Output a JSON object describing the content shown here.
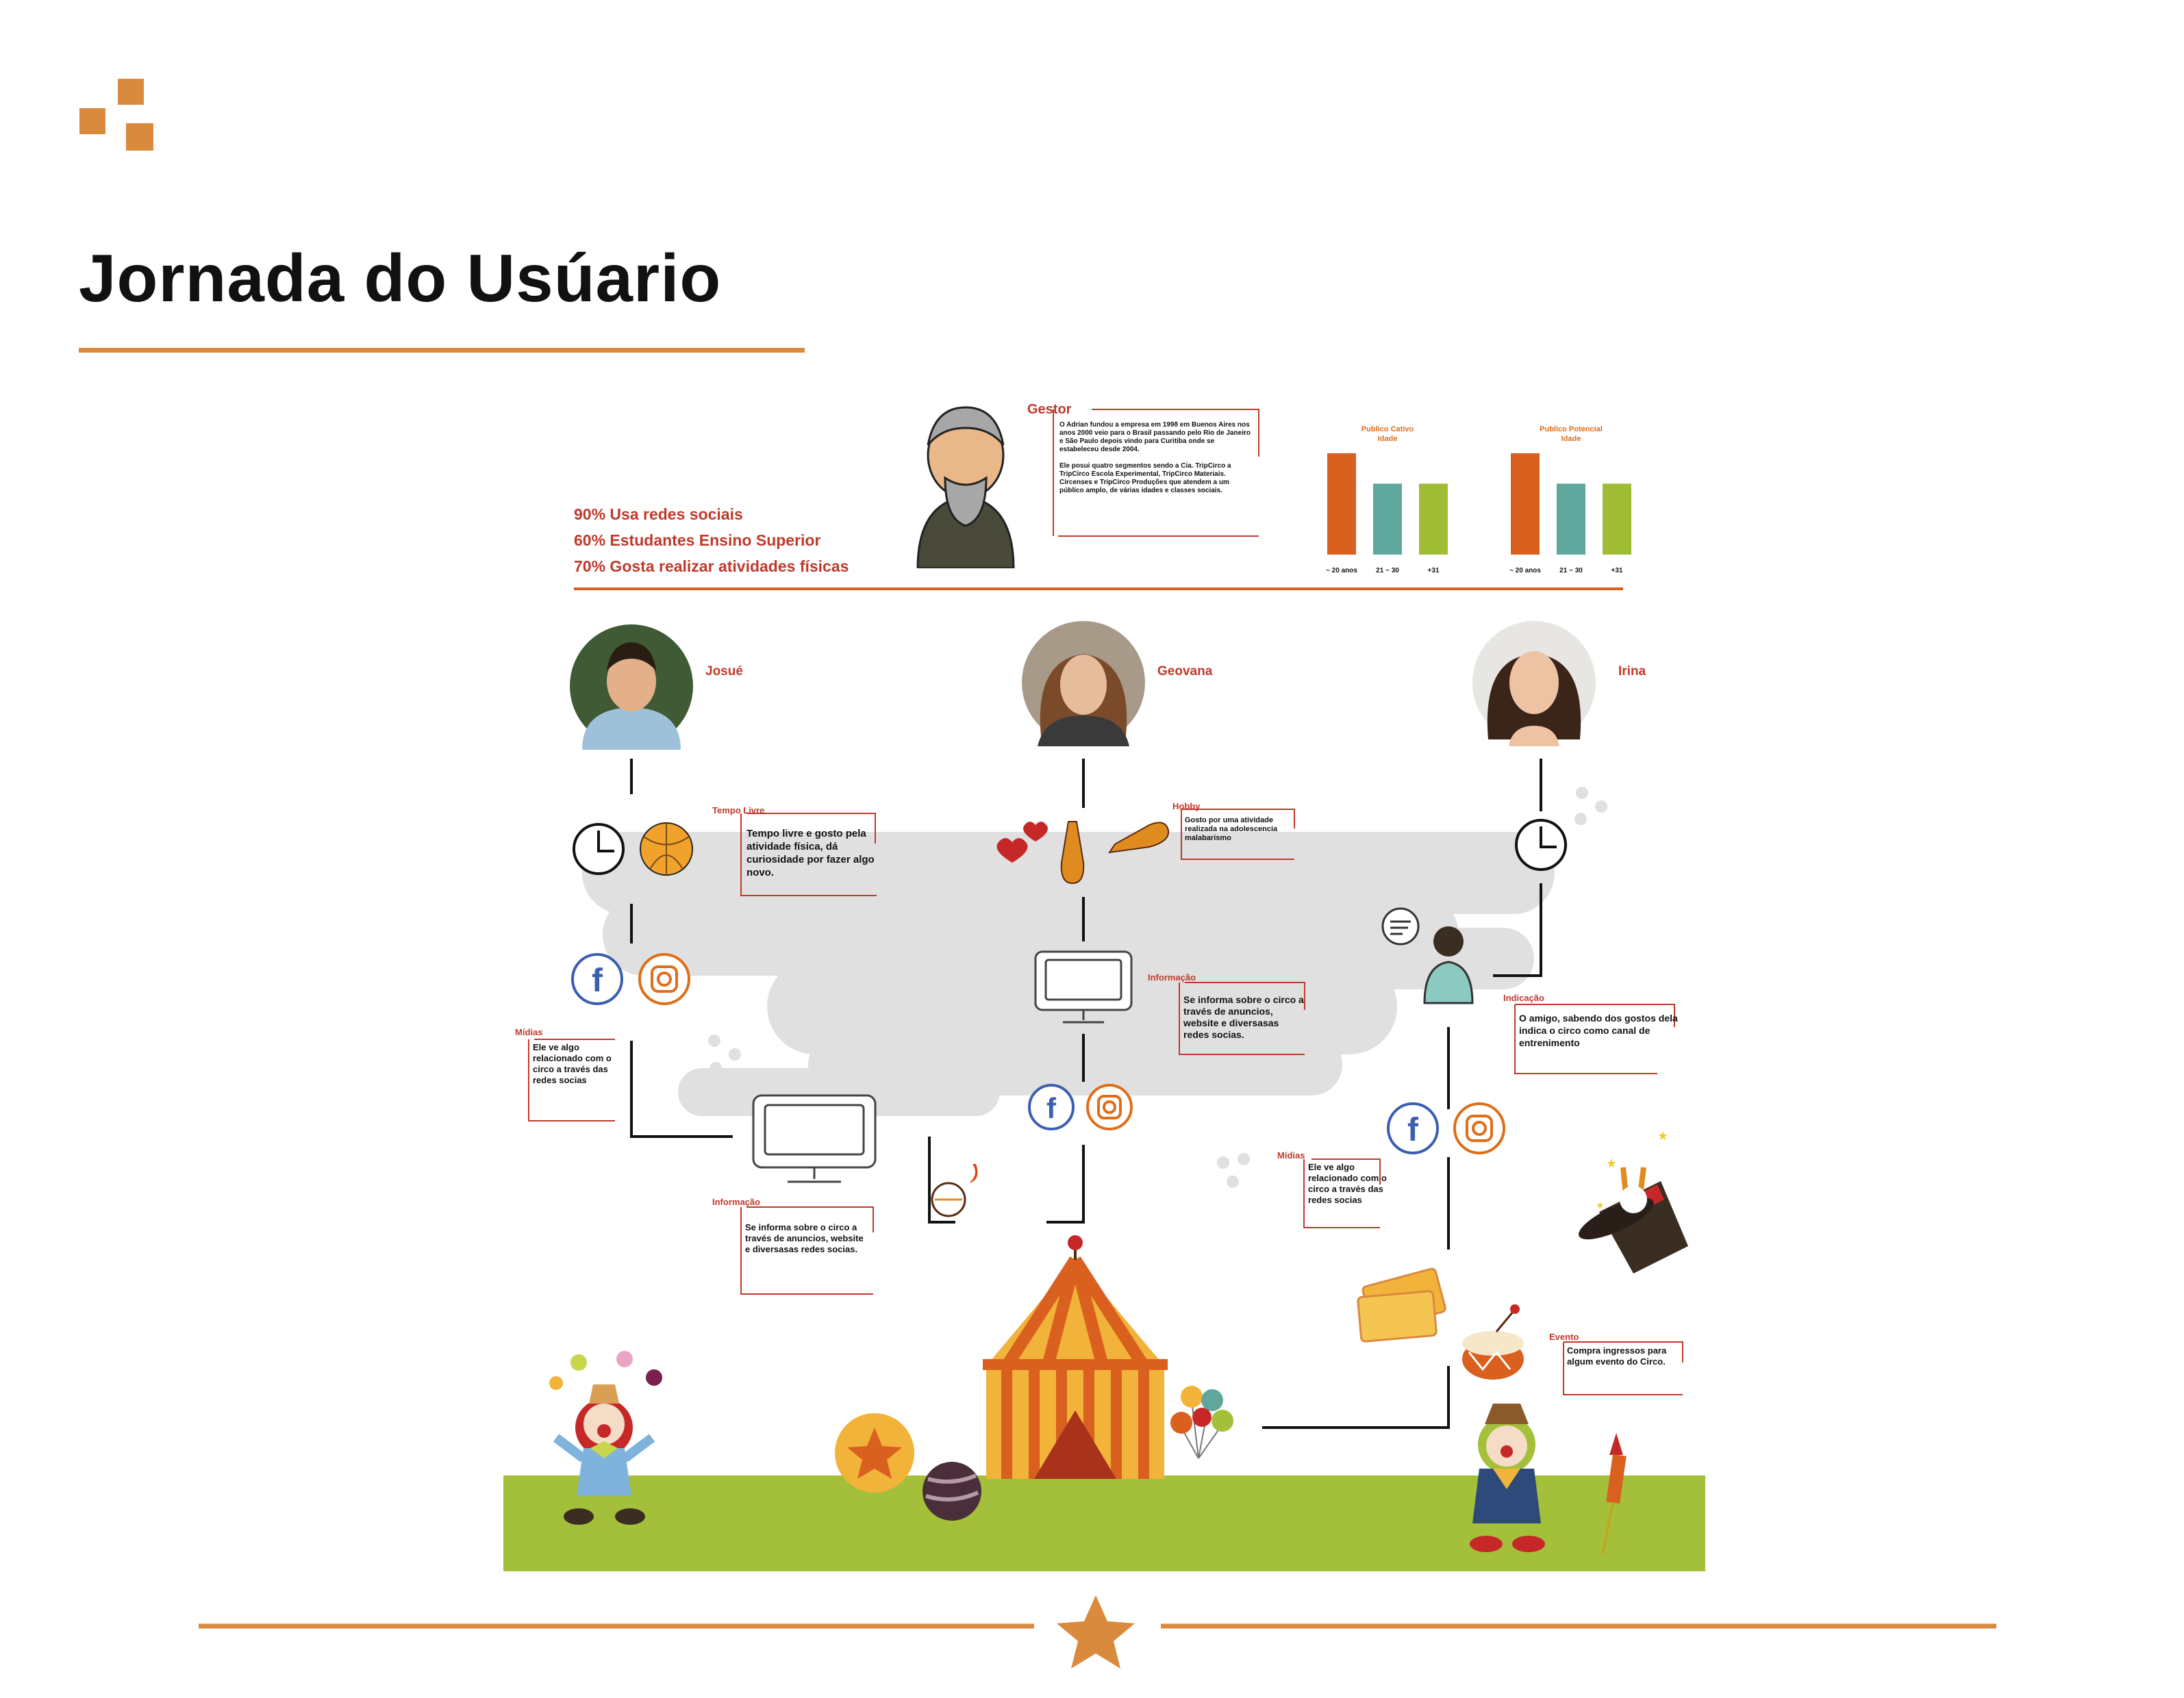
{
  "title": "Jornada do Usúario",
  "stats": [
    "90% Usa redes sociais",
    "60% Estudantes Ensino Superior",
    "70% Gosta realizar atividades físicas"
  ],
  "gestor": {
    "label": "Gestor",
    "text1": "O Adrian fundou a empresa em 1998 em Buenos Aires nos anos 2000 veio para o Brasil passando pelo Rio de Janeiro e São Paulo depois vindo para Curitiba onde se estabeleceu desde 2004.",
    "text2": "Ele posui quatro segmentos sendo a Cia. TripCirco a TripCirco Escola Experimental, TripCirco Materiais. Circenses e TripCirco Produções que atendem a um público  amplo, de várias idades e classes sociais."
  },
  "personas": {
    "josue": "Josué",
    "geovana": "Geovana",
    "irina": "Irina"
  },
  "notes": {
    "tempo_livre": {
      "label": "Tempo Livre",
      "text": "Tempo livre e gosto pela atividade física, dá curiosidade por fazer algo novo."
    },
    "hobby": {
      "label": "Hobby",
      "text": "Gosto por uma atividade realizada na adolescencia malabarismo"
    },
    "informacao_geovana": {
      "label": "Informação",
      "text": "Se informa sobre o circo a través de anuncios, website e diversasas redes socias."
    },
    "indicacao": {
      "label": "Indicação",
      "text": "O amigo, sabendo dos gostos dela indica o circo como canal de entrenimento"
    },
    "midias_josue": {
      "label": "Mídias",
      "text": "Ele ve algo relacionado com o circo a través das redes socias"
    },
    "informacao_josue": {
      "label": "Informação",
      "text": "Se informa sobre o circo a través de anuncios, website e diversasas redes socias."
    },
    "midias_irina": {
      "label": "Mídias",
      "text": "Ele ve algo relacionado com o circo a través das redes socias"
    },
    "evento": {
      "label": "Evento",
      "text": "Compra ingressos para algum evento do Circo."
    }
  },
  "colors": {
    "accent": "#d98a3d",
    "red": "#c0392b",
    "bar_orange": "#d9601e",
    "bar_teal": "#5fa79d",
    "bar_green": "#a0bc35",
    "grass": "#a4bf39",
    "cloud": "#e0e0e0"
  },
  "chart_data": [
    {
      "type": "bar",
      "title": "Publico Cativo Idade",
      "categories": [
        "~ 20 anos",
        "21 ~ 30",
        "+31"
      ],
      "values": [
        100,
        70,
        70
      ],
      "ylim": [
        0,
        100
      ]
    },
    {
      "type": "bar",
      "title": "Publico Potencial Idade",
      "categories": [
        "~ 20 anos",
        "21 ~ 30",
        "+31"
      ],
      "values": [
        100,
        70,
        70
      ],
      "ylim": [
        0,
        100
      ]
    }
  ]
}
